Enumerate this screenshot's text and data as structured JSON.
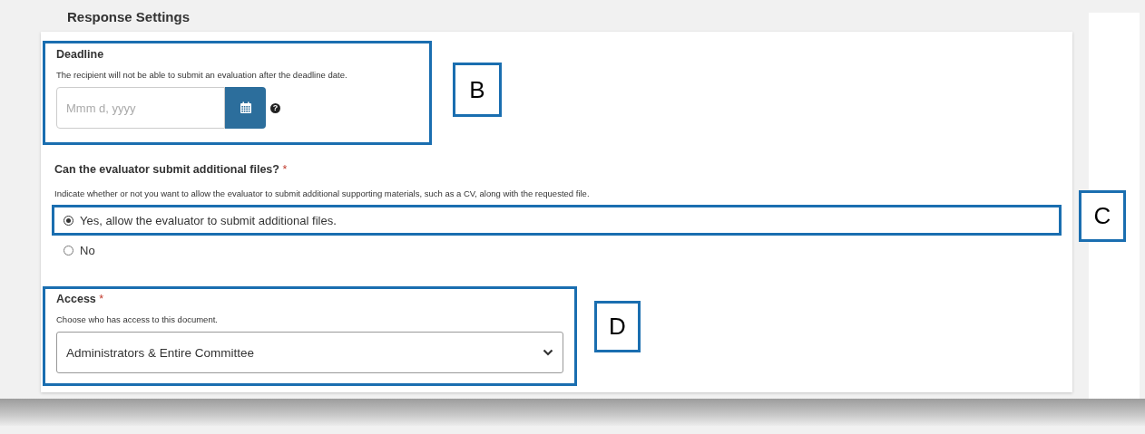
{
  "section": {
    "title": "Response Settings"
  },
  "deadline": {
    "label": "Deadline",
    "description": "The recipient will not be able to submit an evaluation after the deadline date.",
    "date_field": {
      "placeholder": "Mmm d, yyyy"
    },
    "help": "?"
  },
  "additional_files": {
    "label": "Can the evaluator submit additional files?",
    "required_mark": "*",
    "description": "Indicate whether or not you want to allow the evaluator to submit additional supporting materials, such as a CV, along with the requested file.",
    "options": [
      {
        "label": "Yes, allow the evaluator to submit additional files.",
        "selected": true
      },
      {
        "label": "No",
        "selected": false
      }
    ]
  },
  "access": {
    "label": "Access",
    "required_mark": "*",
    "description": "Choose who has access to this document.",
    "select": {
      "value": "Administrators & Entire Committee"
    }
  },
  "callouts": [
    {
      "label": "B"
    },
    {
      "label": "C"
    },
    {
      "label": "D"
    }
  ]
}
